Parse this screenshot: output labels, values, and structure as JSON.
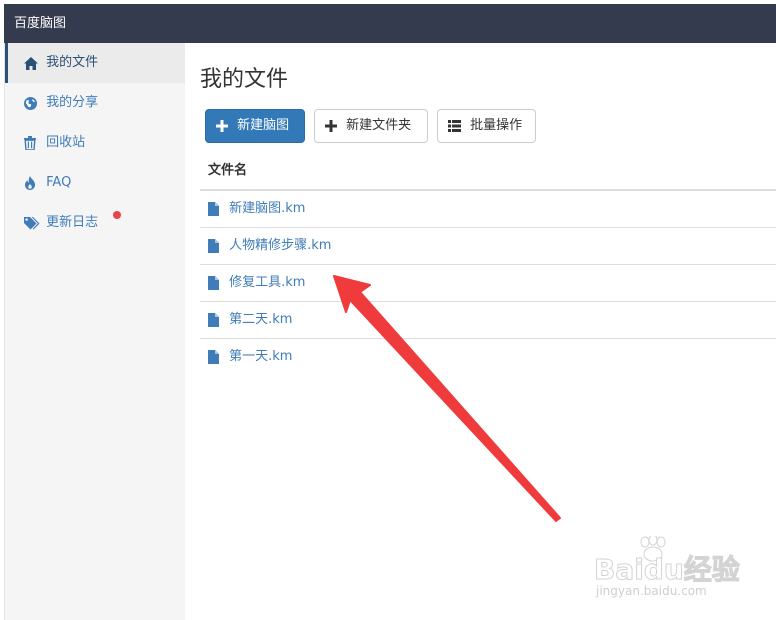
{
  "app": {
    "title": "百度脑图"
  },
  "sidebar": {
    "items": [
      {
        "label": "我的文件",
        "icon": "home-icon"
      },
      {
        "label": "我的分享",
        "icon": "globe-icon"
      },
      {
        "label": "回收站",
        "icon": "trash-icon"
      },
      {
        "label": "FAQ",
        "icon": "fire-icon"
      },
      {
        "label": "更新日志",
        "icon": "tags-icon",
        "has_notification_dot": true
      }
    ],
    "active_index": 0
  },
  "main": {
    "title": "我的文件",
    "toolbar": {
      "new_mindmap_label": "新建脑图",
      "new_folder_label": "新建文件夹",
      "batch_label": "批量操作"
    },
    "table": {
      "header": "文件名",
      "files": [
        "新建脑图.km",
        "人物精修步骤.km",
        "修复工具.km",
        "第二天.km",
        "第一天.km"
      ]
    }
  },
  "watermark": {
    "logo_text": "Baidu经验",
    "url": "jingyan.baidu.com"
  },
  "colors": {
    "topbar": "#343b4e",
    "link": "#3f7cb8",
    "primary_button": "#3379b7",
    "arrow": "#ef3b3b",
    "notification_dot": "#e94545"
  }
}
